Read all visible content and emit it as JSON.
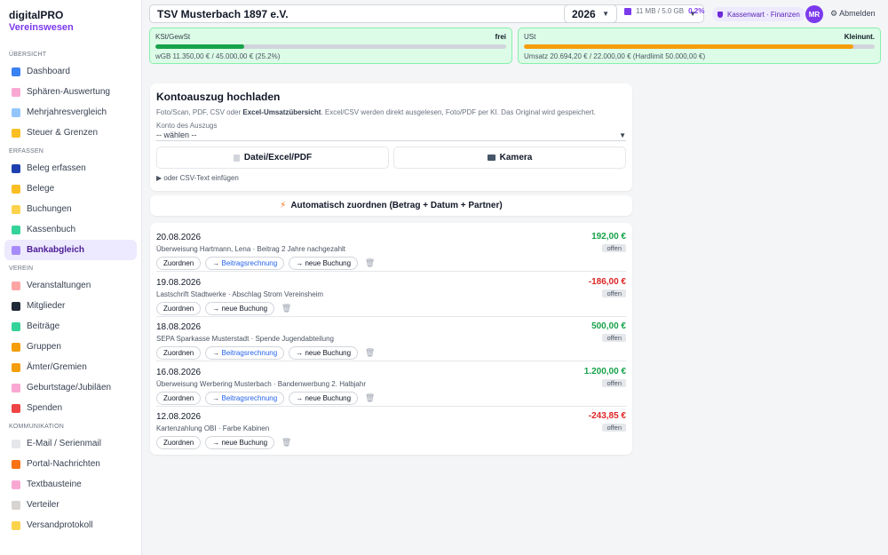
{
  "brand": {
    "name": "digitalPRO",
    "sub": "Vereinswesen"
  },
  "sidebar": {
    "sections": [
      {
        "title": "Übersicht",
        "items": [
          {
            "label": "Dashboard",
            "icon": "bar-chart-icon",
            "color": "#3b82f6"
          },
          {
            "label": "Sphären-Auswertung",
            "icon": "pie-chart-icon",
            "color": "#f9a8d4"
          },
          {
            "label": "Mehrjahresvergleich",
            "icon": "trend-chart-icon",
            "color": "#93c5fd"
          },
          {
            "label": "Steuer & Grenzen",
            "icon": "scale-icon",
            "color": "#fbbf24"
          }
        ]
      },
      {
        "title": "Erfassen",
        "items": [
          {
            "label": "Beleg erfassen",
            "icon": "plus-icon",
            "color": "#1e40af"
          },
          {
            "label": "Belege",
            "icon": "folder-icon",
            "color": "#fbbf24"
          },
          {
            "label": "Buchungen",
            "icon": "notepad-icon",
            "color": "#fcd34d"
          },
          {
            "label": "Kassenbuch",
            "icon": "cash-icon",
            "color": "#34d399"
          },
          {
            "label": "Bankabgleich",
            "icon": "bank-icon",
            "color": "#a78bfa",
            "active": true
          }
        ]
      },
      {
        "title": "Verein",
        "items": [
          {
            "label": "Veranstaltungen",
            "icon": "calendar-icon",
            "color": "#fca5a5"
          },
          {
            "label": "Mitglieder",
            "icon": "people-icon",
            "color": "#1f2937"
          },
          {
            "label": "Beiträge",
            "icon": "money-icon",
            "color": "#34d399"
          },
          {
            "label": "Gruppen",
            "icon": "tag-icon",
            "color": "#f59e0b"
          },
          {
            "label": "Ämter/Gremien",
            "icon": "medal-icon",
            "color": "#f59e0b"
          },
          {
            "label": "Geburtstage/Jubiläen",
            "icon": "cake-icon",
            "color": "#f9a8d4"
          },
          {
            "label": "Spenden",
            "icon": "gift-icon",
            "color": "#ef4444"
          }
        ]
      },
      {
        "title": "Kommunikation",
        "items": [
          {
            "label": "E-Mail / Serienmail",
            "icon": "envelope-icon",
            "color": "#e5e7eb"
          },
          {
            "label": "Portal-Nachrichten",
            "icon": "megaphone-icon",
            "color": "#f97316"
          },
          {
            "label": "Textbausteine",
            "icon": "puzzle-icon",
            "color": "#f9a8d4"
          },
          {
            "label": "Verteiler",
            "icon": "clipboard-icon",
            "color": "#d6d3d1"
          },
          {
            "label": "Versandprotokoll",
            "icon": "scroll-icon",
            "color": "#fcd34d"
          }
        ]
      }
    ]
  },
  "topbar": {
    "club": "TSV Musterbach 1897 e.V.",
    "year": "2026",
    "storage_used": "11 MB / 5.0 GB",
    "storage_pct": "0.2%",
    "role": "Kassenwart · Finanzen",
    "avatar": "MR",
    "logout": "Abmelden"
  },
  "limits": [
    {
      "title": "KSt/GewSt",
      "status": "frei",
      "detail": "wGB 11.350,00 € / 45.000,00 € (25.2%)",
      "fill_pct": 25.2,
      "color": "#16a34a"
    },
    {
      "title": "USt",
      "status": "Kleinunt.",
      "detail": "Umsatz 20.694,20 € / 22.000,00 € (Hardlimit 50.000,00 €)",
      "fill_pct": 94,
      "color": "#f59e0b"
    }
  ],
  "upload": {
    "title": "Kontoauszug hochladen",
    "hint_pre": "Foto/Scan, PDF, CSV oder ",
    "hint_bold": "Excel-Umsatzübersicht",
    "hint_post": ". Excel/CSV werden direkt ausgelesen, Foto/PDF per KI. Das Original wird gespeichert.",
    "account_label": "Konto des Auszugs",
    "account_value": "-- wählen --",
    "file_button": "Datei/Excel/PDF",
    "camera_button": "Kamera",
    "csv_toggle": "▶  oder CSV-Text einfügen"
  },
  "auto_assign": {
    "label": "Automatisch zuordnen (Betrag + Datum + Partner)"
  },
  "transactions": [
    {
      "date": "20.08.2026",
      "desc": "Überweisung Hartmann, Lena · Beitrag 2 Jahre nachgezahlt",
      "amount": "192,00 €",
      "status": "offen",
      "positive": true,
      "has_beitrag": true
    },
    {
      "date": "19.08.2026",
      "desc": "Lastschrift Stadtwerke · Abschlag Strom Vereinsheim",
      "amount": "-186,00 €",
      "status": "offen",
      "positive": false,
      "has_beitrag": false
    },
    {
      "date": "18.08.2026",
      "desc": "SEPA Sparkasse Musterstadt · Spende Jugendabteilung",
      "amount": "500,00 €",
      "status": "offen",
      "positive": true,
      "has_beitrag": true
    },
    {
      "date": "16.08.2026",
      "desc": "Überweisung Werbering Musterbach · Bandenwerbung 2. Halbjahr",
      "amount": "1.200,00 €",
      "status": "offen",
      "positive": true,
      "has_beitrag": true
    },
    {
      "date": "12.08.2026",
      "desc": "Kartenzahlung OBI · Farbe Kabinen",
      "amount": "-243,85 €",
      "status": "offen",
      "positive": false,
      "has_beitrag": false
    }
  ],
  "actions": {
    "assign": "Zuordnen",
    "beitrag": "Beitragsrechnung",
    "new_booking": "neue Buchung",
    "arrow": "→"
  }
}
